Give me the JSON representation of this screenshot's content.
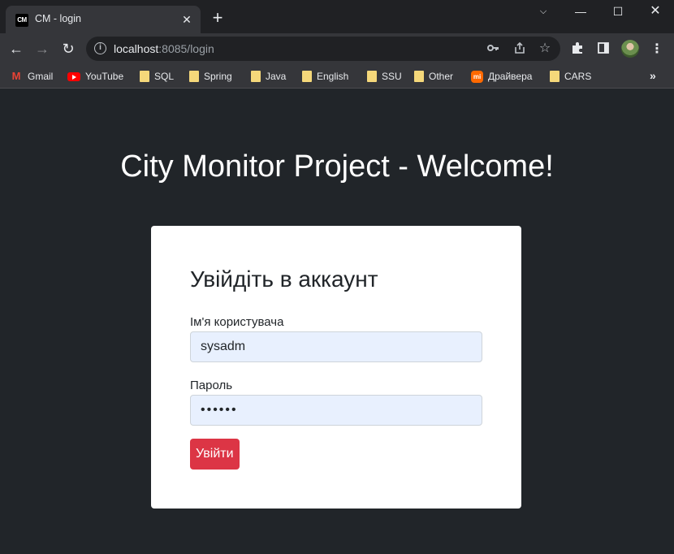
{
  "browser": {
    "tab": {
      "favicon_text": "CM",
      "title": "CM - login",
      "close": "✕"
    },
    "new_tab": "+",
    "window_controls": {
      "tab_search": "⌵",
      "minimize": "—",
      "maximize": "☐",
      "close": "✕"
    },
    "nav": {
      "back": "←",
      "forward": "→",
      "reload": "↻"
    },
    "address": {
      "host": "localhost",
      "rest": ":8085/login"
    },
    "omni_icons": [
      "key-icon",
      "share-icon",
      "star-icon"
    ],
    "toolbar_icons": [
      "extensions-icon",
      "side-panel-icon",
      "avatar",
      "menu-icon"
    ],
    "bookmarks": [
      {
        "label": "Gmail",
        "icon": "gmail-icon"
      },
      {
        "label": "YouTube",
        "icon": "youtube-icon"
      },
      {
        "label": "SQL",
        "icon": "folder-icon"
      },
      {
        "label": "Spring",
        "icon": "folder-icon"
      },
      {
        "label": "Java",
        "icon": "folder-icon"
      },
      {
        "label": "English",
        "icon": "folder-icon"
      },
      {
        "label": "SSU",
        "icon": "folder-icon"
      },
      {
        "label": "Other",
        "icon": "folder-icon"
      },
      {
        "label": "Драйвера",
        "icon": "mi-icon"
      },
      {
        "label": "CARS",
        "icon": "folder-icon"
      }
    ],
    "bookmarks_overflow": "»"
  },
  "page": {
    "heading": "City Monitor Project - Welcome!",
    "card": {
      "title": "Увійдіть в аккаунт",
      "username_label": "Ім'я користувача",
      "username_value": "sysadm",
      "password_label": "Пароль",
      "password_value": "••••••",
      "submit_label": "Увійти"
    },
    "colors": {
      "background": "#212529",
      "card": "#ffffff",
      "button": "#dc3545",
      "autofill": "#e8f0fe"
    }
  }
}
